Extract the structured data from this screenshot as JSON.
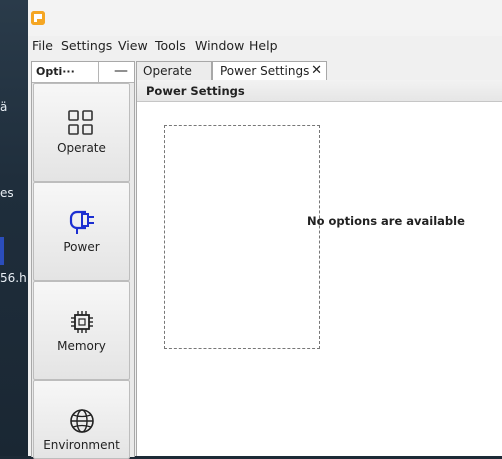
{
  "desktop": {
    "frag1": "ä",
    "frag2": "es",
    "frag3": "56.h"
  },
  "menu": [
    "File",
    "Settings",
    "View",
    "Tools",
    "Window",
    "Help"
  ],
  "options_panel": {
    "title": "Opti···",
    "minimize": "—",
    "items": [
      {
        "label": "Operate",
        "icon": "grid-icon"
      },
      {
        "label": "Power",
        "icon": "power-plug-icon"
      },
      {
        "label": "Memory",
        "icon": "chip-icon"
      },
      {
        "label": "Environment",
        "icon": "globe-icon"
      }
    ]
  },
  "tabs": [
    {
      "label": "Operate",
      "active": false
    },
    {
      "label": "Power Settings",
      "active": true,
      "close": "✕"
    }
  ],
  "content": {
    "title": "Power Settings",
    "message": "No options are available"
  },
  "colors": {
    "power_icon": "#1c2fd1",
    "app_icon": "#f5a623"
  }
}
